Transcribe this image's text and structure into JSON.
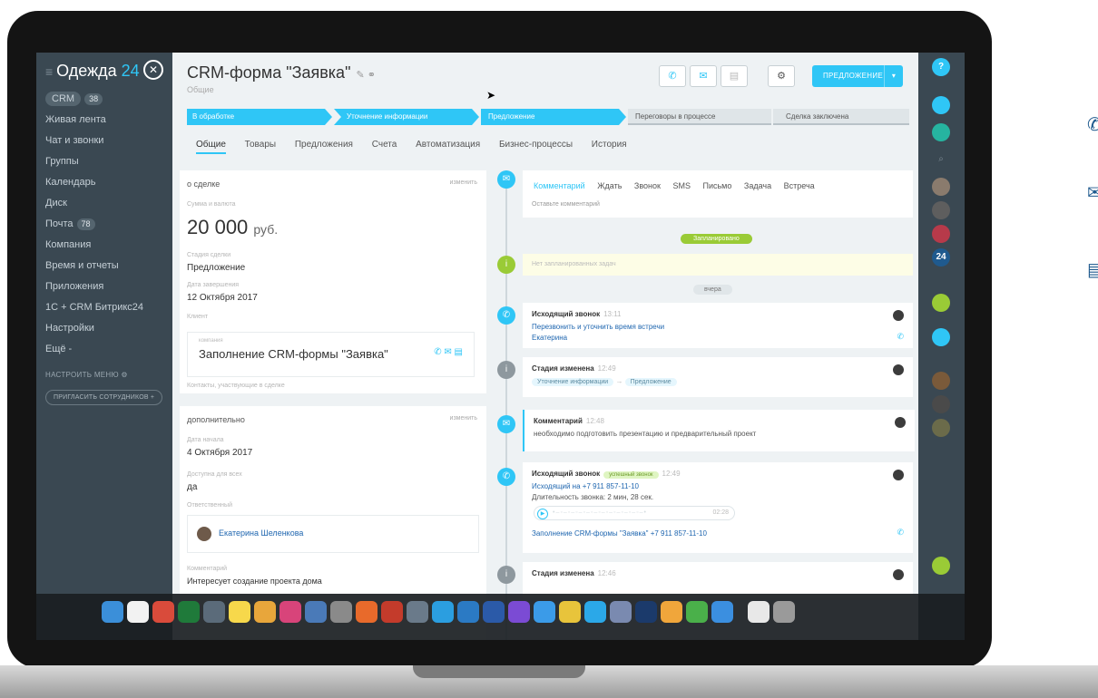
{
  "sidebar": {
    "brand_name": "Одежда",
    "brand_num": "24",
    "burger_icon": "≡",
    "close_icon": "✕",
    "items": [
      {
        "label": "CRM",
        "badge": "38"
      },
      {
        "label": "Живая лента",
        "badge": ""
      },
      {
        "label": "Чат и звонки",
        "badge": ""
      },
      {
        "label": "Группы",
        "badge": ""
      },
      {
        "label": "Календарь",
        "badge": ""
      },
      {
        "label": "Диск",
        "badge": ""
      },
      {
        "label": "Почта",
        "badge": "78"
      },
      {
        "label": "Компания",
        "badge": ""
      },
      {
        "label": "Время и отчеты",
        "badge": ""
      },
      {
        "label": "Приложения",
        "badge": ""
      },
      {
        "label": "1С + CRM Битрикс24",
        "badge": ""
      },
      {
        "label": "Настройки",
        "badge": ""
      },
      {
        "label": "Ещё -",
        "badge": ""
      }
    ],
    "setup_menu": "НАСТРОИТЬ МЕНЮ",
    "setup_gear": "⚙",
    "invite": "ПРИГЛАСИТЬ СОТРУДНИКОВ",
    "invite_plus": "+"
  },
  "header": {
    "title": "CRM-форма \"Заявка\"",
    "edit_icons": "✎ ⚭",
    "subtitle": "Общие",
    "proposal_button": "ПРЕДЛОЖЕНИЕ",
    "caret": "▾",
    "btn_icons": {
      "phone": "✆",
      "mail": "✉",
      "chat": "▤",
      "gear": "⚙"
    },
    "cursor": "➤"
  },
  "stages": [
    {
      "label": "В обработке",
      "state": "done"
    },
    {
      "label": "Уточнение информации",
      "state": "done"
    },
    {
      "label": "Предложение",
      "state": "done"
    },
    {
      "label": "Переговоры в процессе",
      "state": "todo"
    },
    {
      "label": "Сделка заключена",
      "state": "todo"
    }
  ],
  "tabs": [
    {
      "label": "Общие",
      "active": true
    },
    {
      "label": "Товары",
      "active": false
    },
    {
      "label": "Предложения",
      "active": false
    },
    {
      "label": "Счета",
      "active": false
    },
    {
      "label": "Автоматизация",
      "active": false
    },
    {
      "label": "Бизнес-процессы",
      "active": false
    },
    {
      "label": "История",
      "active": false
    }
  ],
  "about": {
    "header": "о сделке",
    "edit": "изменить",
    "amount_label": "Сумма и валюта",
    "amount": "20 000",
    "currency": "руб.",
    "stage_label": "Стадия сделки",
    "stage": "Предложение",
    "close_label": "Дата завершения",
    "close_date": "12 Октября 2017",
    "client_label": "Клиент",
    "client_sub": "компания",
    "client_name": "Заполнение CRM-формы \"Заявка\"",
    "client_icons": "✆ ✉ ▤",
    "contacts": "Контакты, участвующие в сделке"
  },
  "extra": {
    "header": "дополнительно",
    "edit": "изменить",
    "start_label": "Дата начала",
    "start_date": "4 Октября 2017",
    "available_label": "Доступна для всех",
    "available": "да",
    "responsible_label": "Ответственный",
    "responsible": "Екатерина Шеленкова",
    "comment_label": "Комментарий",
    "comment": "Интересует создание проекта дома"
  },
  "activity": {
    "tabs": [
      "Комментарий",
      "Ждать",
      "Звонок",
      "SMS",
      "Письмо",
      "Задача",
      "Встреча"
    ],
    "placeholder": "Оставьте комментарий",
    "planned": "Запланировано",
    "no_tasks": "Нет запланированных задач",
    "yesterday": "вчера"
  },
  "timeline": [
    {
      "title": "Исходящий звонок",
      "time": "13:11",
      "line1": "Перезвонить и уточнить время встречи",
      "line2": "Екатерина"
    },
    {
      "title": "Стадия изменена",
      "time": "12:49",
      "from": "Уточнение информации",
      "arrow": "→",
      "to": "Предложение"
    },
    {
      "title": "Комментарий",
      "time": "12:48",
      "text": "необходимо подготовить презентацию и предварительный проект"
    },
    {
      "title": "Исходящий звонок",
      "status": "успешный звонок",
      "time": "12:49",
      "line1": "Исходящий на +7 911 857-11-10",
      "line2": "Длительность звонка: 2 мин, 28 сек.",
      "audio_dur": "02:28",
      "line3": "Заполнение CRM-формы \"Заявка\" +7 911 857-11-10"
    },
    {
      "title": "Стадия изменена",
      "time": "12:46"
    }
  ],
  "right_panel": {
    "help": "?",
    "num": "24",
    "search": "⌕"
  },
  "icons": {
    "phone": "✆",
    "info": "i",
    "comment": "✉",
    "play": "▶"
  },
  "colors": {
    "accent": "#2fc6f6",
    "sidebar": "#3a4852",
    "success": "#9acb36",
    "bg": "#eef2f4"
  }
}
